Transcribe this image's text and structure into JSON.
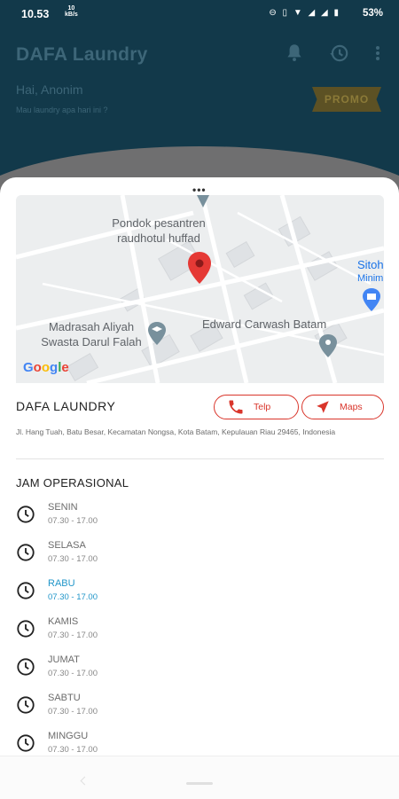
{
  "status_bar": {
    "time": "10.53",
    "net_speed_value": "10",
    "net_speed_unit": "kB/s",
    "battery": "53%"
  },
  "header": {
    "app_title": "DAFA Laundry",
    "greeting": "Hai, Anonim",
    "subtitle": "Mau laundry apa hari ini ?",
    "promo_label": "PROMO",
    "icons": [
      "bell-icon",
      "history-icon",
      "more-vert-icon"
    ]
  },
  "map": {
    "labels": {
      "pondok": "Pondok pesantren raudhotul huffad",
      "sitoh": "Sitoh",
      "minim": "Minim",
      "madrasah": "Madrasah Aliyah Swasta Darul Falah",
      "carwash": "Edward Carwash Batam"
    },
    "attribution": "Google"
  },
  "store": {
    "name": "DAFA LAUNDRY",
    "address": "Jl. Hang Tuah, Batu Besar, Kecamatan Nongsa, Kota Batam, Kepulauan Riau 29465, Indonesia",
    "telp_label": "Telp",
    "maps_label": "Maps"
  },
  "operational": {
    "title": "JAM OPERASIONAL",
    "days": [
      {
        "name": "SENIN",
        "hours": "07.30 - 17.00",
        "active": false
      },
      {
        "name": "SELASA",
        "hours": "07.30 - 17.00",
        "active": false
      },
      {
        "name": "RABU",
        "hours": "07.30 - 17.00",
        "active": true
      },
      {
        "name": "KAMIS",
        "hours": "07.30 - 17.00",
        "active": false
      },
      {
        "name": "JUMAT",
        "hours": "07.30 - 17.00",
        "active": false
      },
      {
        "name": "SABTU",
        "hours": "07.30 - 17.00",
        "active": false
      },
      {
        "name": "MINGGU",
        "hours": "07.30 - 17.00",
        "active": false
      }
    ]
  },
  "colors": {
    "header_bg": "#12394a",
    "accent_red": "#d9352b",
    "active_day": "#2196c9"
  }
}
